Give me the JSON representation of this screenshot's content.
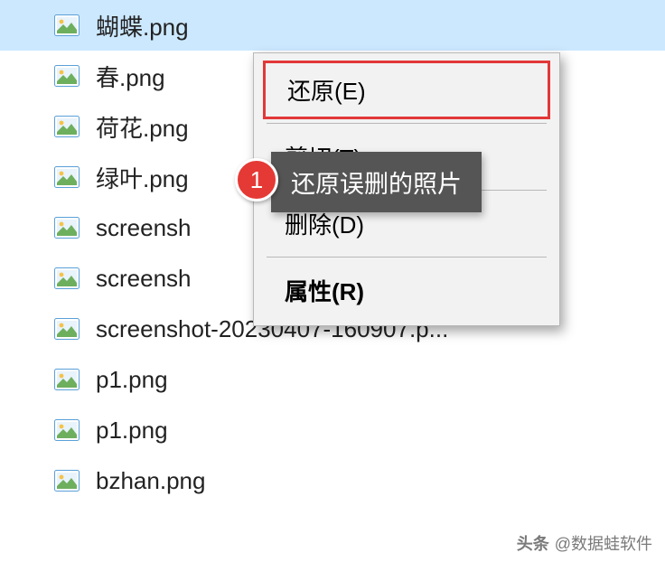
{
  "files": [
    {
      "name": "蝴蝶.png",
      "selected": true
    },
    {
      "name": "春.png",
      "selected": false
    },
    {
      "name": "荷花.png",
      "selected": false
    },
    {
      "name": "绿叶.png",
      "selected": false
    },
    {
      "name": "screensh",
      "selected": false
    },
    {
      "name": "screensh",
      "selected": false
    },
    {
      "name": "screenshot-20230407-160907.p...",
      "selected": false
    },
    {
      "name": "p1.png",
      "selected": false
    },
    {
      "name": "p1.png",
      "selected": false
    },
    {
      "name": "bzhan.png",
      "selected": false
    }
  ],
  "menu": {
    "restore": "还原(E)",
    "cut": "剪切(T)",
    "delete": "删除(D)",
    "properties": "属性(R)"
  },
  "tooltip": {
    "text": "还原误删的照片"
  },
  "badge": {
    "number": "1"
  },
  "watermark": {
    "prefix": "头条",
    "author": "@数据蛙软件"
  }
}
